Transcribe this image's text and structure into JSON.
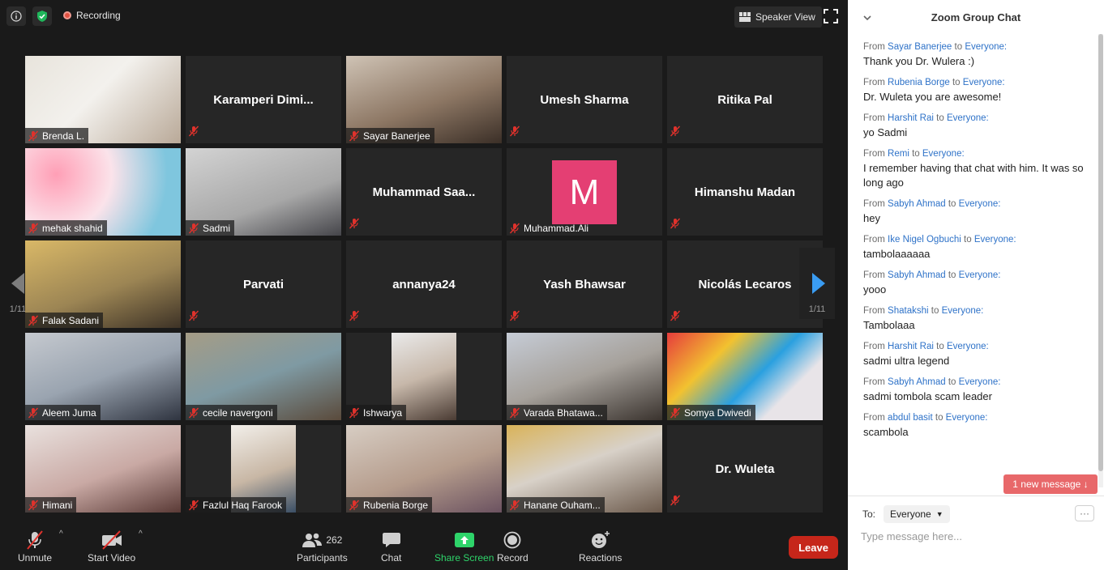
{
  "topbar": {
    "recording_label": "Recording",
    "speaker_view_label": "Speaker View"
  },
  "grid": {
    "tiles": [
      {
        "name": "Brenda L.",
        "type": "video",
        "bg": "linear-gradient(135deg,#e8e4dc,#f3f1ed 45%,#b9a998)"
      },
      {
        "name": "Karamperi  Dimi...",
        "type": "name"
      },
      {
        "name": "Sayar Banerjee",
        "type": "video",
        "bg": "linear-gradient(160deg,#cfc3b5,#8d7764 55%,#3b2f27)"
      },
      {
        "name": "Umesh Sharma",
        "type": "name"
      },
      {
        "name": "Ritika Pal",
        "type": "name"
      },
      {
        "name": "mehak shahid",
        "type": "video",
        "bg": "radial-gradient(circle at 20% 30%,#ff9fb6,#fbe3ea 40%,#7fc6de 80%)"
      },
      {
        "name": "Sadmi",
        "type": "video",
        "active": true,
        "bg": "linear-gradient(160deg,#d3d3d3,#a8a8a8 60%,#45454a)"
      },
      {
        "name": "Muhammad  Saa...",
        "type": "name"
      },
      {
        "name": "Muhammad.Ali",
        "type": "avatar",
        "avatar": "M"
      },
      {
        "name": "Himanshu Madan",
        "type": "name"
      },
      {
        "name": "Falak Sadani",
        "type": "video",
        "bg": "linear-gradient(160deg,#d9b867,#9c8554 55%,#3d3226)"
      },
      {
        "name": "Parvati",
        "type": "name"
      },
      {
        "name": "annanya24",
        "type": "name"
      },
      {
        "name": "Yash Bhawsar",
        "type": "name"
      },
      {
        "name": "Nicolás Lecaros",
        "type": "name"
      },
      {
        "name": "Aleem Juma",
        "type": "video",
        "bg": "linear-gradient(160deg,#c5c9cf,#9aa4b0 50%,#2f3440)"
      },
      {
        "name": "cecile navergoni",
        "type": "video",
        "bg": "linear-gradient(160deg,#a59c86,#7f9aa3 50%,#5a4a3b)"
      },
      {
        "name": "Ishwarya",
        "type": "video",
        "inset": true,
        "bg": "linear-gradient(160deg,#eaeaea,#c7b8aa 50%,#4a3b33)"
      },
      {
        "name": "Varada Bhatawa...",
        "type": "video",
        "bg": "linear-gradient(160deg,#c6ccd6,#a6a19b 50%,#3a332e)"
      },
      {
        "name": "Somya Dwivedi",
        "type": "video",
        "bg": "linear-gradient(135deg,#e63c3c,#f2c230 30%,#2aa0e0 55%,#e8e4e8 75%)"
      },
      {
        "name": "Himani",
        "type": "video",
        "bg": "linear-gradient(160deg,#e9e1de,#c9a9a4 55%,#5a3a36)"
      },
      {
        "name": "Fazlul Haq Farook",
        "type": "video",
        "inset": true,
        "bg": "linear-gradient(160deg,#f2efea,#c8b7a5 55%,#3b4f66)"
      },
      {
        "name": "Rubenia Borge",
        "type": "video",
        "bg": "linear-gradient(160deg,#d7cdc3,#b59c8c 55%,#6b5260)"
      },
      {
        "name": "Hanane Ouham...",
        "type": "video",
        "bg": "linear-gradient(160deg,#d9b35a,#d8d1c8 45%,#6c5a4c)"
      },
      {
        "name": "Dr. Wuleta",
        "type": "name"
      }
    ]
  },
  "pager": {
    "left_page": "1/11",
    "right_page": "1/11"
  },
  "toolbar": {
    "unmute_label": "Unmute",
    "start_video_label": "Start Video",
    "participants_label": "Participants",
    "participants_count": "262",
    "chat_label": "Chat",
    "share_label": "Share Screen",
    "record_label": "Record",
    "reactions_label": "Reactions",
    "leave_label": "Leave"
  },
  "chat": {
    "title": "Zoom Group Chat",
    "from_word": "From",
    "to_word": "to",
    "messages": [
      {
        "from": "Sayar Banerjee",
        "to": "Everyone:",
        "text": "Thank you Dr. Wulera :)"
      },
      {
        "from": "Rubenia Borge",
        "to": "Everyone:",
        "text": "Dr. Wuleta you are awesome!"
      },
      {
        "from": "Harshit Rai",
        "to": "Everyone:",
        "text": "yo Sadmi"
      },
      {
        "from": "Remi",
        "to": "Everyone:",
        "text": "I remember having that chat with him. It was so long ago"
      },
      {
        "from": "Sabyh Ahmad",
        "to": "Everyone:",
        "text": "hey"
      },
      {
        "from": "Ike Nigel Ogbuchi",
        "to": "Everyone:",
        "text": "tambolaaaaaa"
      },
      {
        "from": "Sabyh Ahmad",
        "to": "Everyone:",
        "text": "yooo"
      },
      {
        "from": "Shatakshi",
        "to": "Everyone:",
        "text": "Tambolaaa"
      },
      {
        "from": "Harshit Rai",
        "to": "Everyone:",
        "text": "sadmi ultra legend"
      },
      {
        "from": "Sabyh Ahmad",
        "to": "Everyone:",
        "text": "sadmi tombola scam leader"
      },
      {
        "from": "abdul basit",
        "to": "Everyone:",
        "text": "scambola"
      }
    ],
    "new_message_label": "1 new message ↓",
    "to_label": "To:",
    "recipient": "Everyone",
    "more_label": "···",
    "input_placeholder": "Type message here..."
  },
  "colors": {
    "accent_green": "#2ed46a",
    "leave_red": "#c6261a",
    "active_speaker": "#c7e26a",
    "chat_name_blue": "#2e72c8",
    "new_message_bg": "#e8686a",
    "avatar_pink": "#e43f73"
  }
}
